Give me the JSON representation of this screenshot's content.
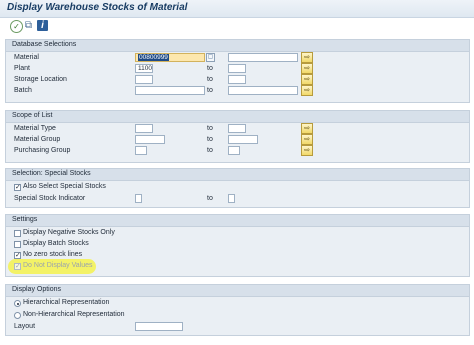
{
  "window": {
    "title": "Display Warehouse Stocks of Material"
  },
  "toolbar": {
    "icons": [
      "execute-icon",
      "get-variant-icon",
      "info-icon"
    ]
  },
  "database_selections": {
    "header": "Database Selections",
    "material": {
      "label": "Material",
      "value": "00800999",
      "to_value": ""
    },
    "plant": {
      "label": "Plant",
      "value": "1100",
      "to_label": "to",
      "to_value": ""
    },
    "storage_location": {
      "label": "Storage Location",
      "value": "",
      "to_label": "to",
      "to_value": ""
    },
    "batch": {
      "label": "Batch",
      "value": "",
      "to_label": "to",
      "to_value": ""
    }
  },
  "scope_of_list": {
    "header": "Scope of List",
    "material_type": {
      "label": "Material Type",
      "value": "",
      "to_label": "to",
      "to_value": ""
    },
    "material_group": {
      "label": "Material Group",
      "value": "",
      "to_label": "to",
      "to_value": ""
    },
    "purchasing_group": {
      "label": "Purchasing Group",
      "value": "",
      "to_label": "to",
      "to_value": ""
    }
  },
  "special_stocks": {
    "header": "Selection: Special Stocks",
    "also_select": {
      "label": "Also Select Special Stocks",
      "checked": true
    },
    "indicator": {
      "label": "Special Stock Indicator",
      "value": "",
      "to_label": "to",
      "to_value": ""
    }
  },
  "settings": {
    "header": "Settings",
    "negative_stocks": {
      "label": "Display Negative Stocks Only",
      "checked": false
    },
    "batch_stocks": {
      "label": "Display Batch Stocks",
      "checked": false
    },
    "no_zero": {
      "label": "No zero stock lines",
      "checked": true
    },
    "no_values": {
      "label": "Do Not Display Values",
      "checked": true,
      "disabled": true
    },
    "highlight_color": "#f3f25a"
  },
  "display_options": {
    "header": "Display Options",
    "hierarchical": {
      "label": "Hierarchical Representation",
      "selected": true
    },
    "non_hierarchical": {
      "label": "Non-Hierarchical Representation",
      "selected": false
    },
    "layout": {
      "label": "Layout",
      "value": ""
    }
  },
  "glyphs": {
    "multiple_selection": "⇨",
    "value_help": "▢",
    "check": "✓"
  }
}
